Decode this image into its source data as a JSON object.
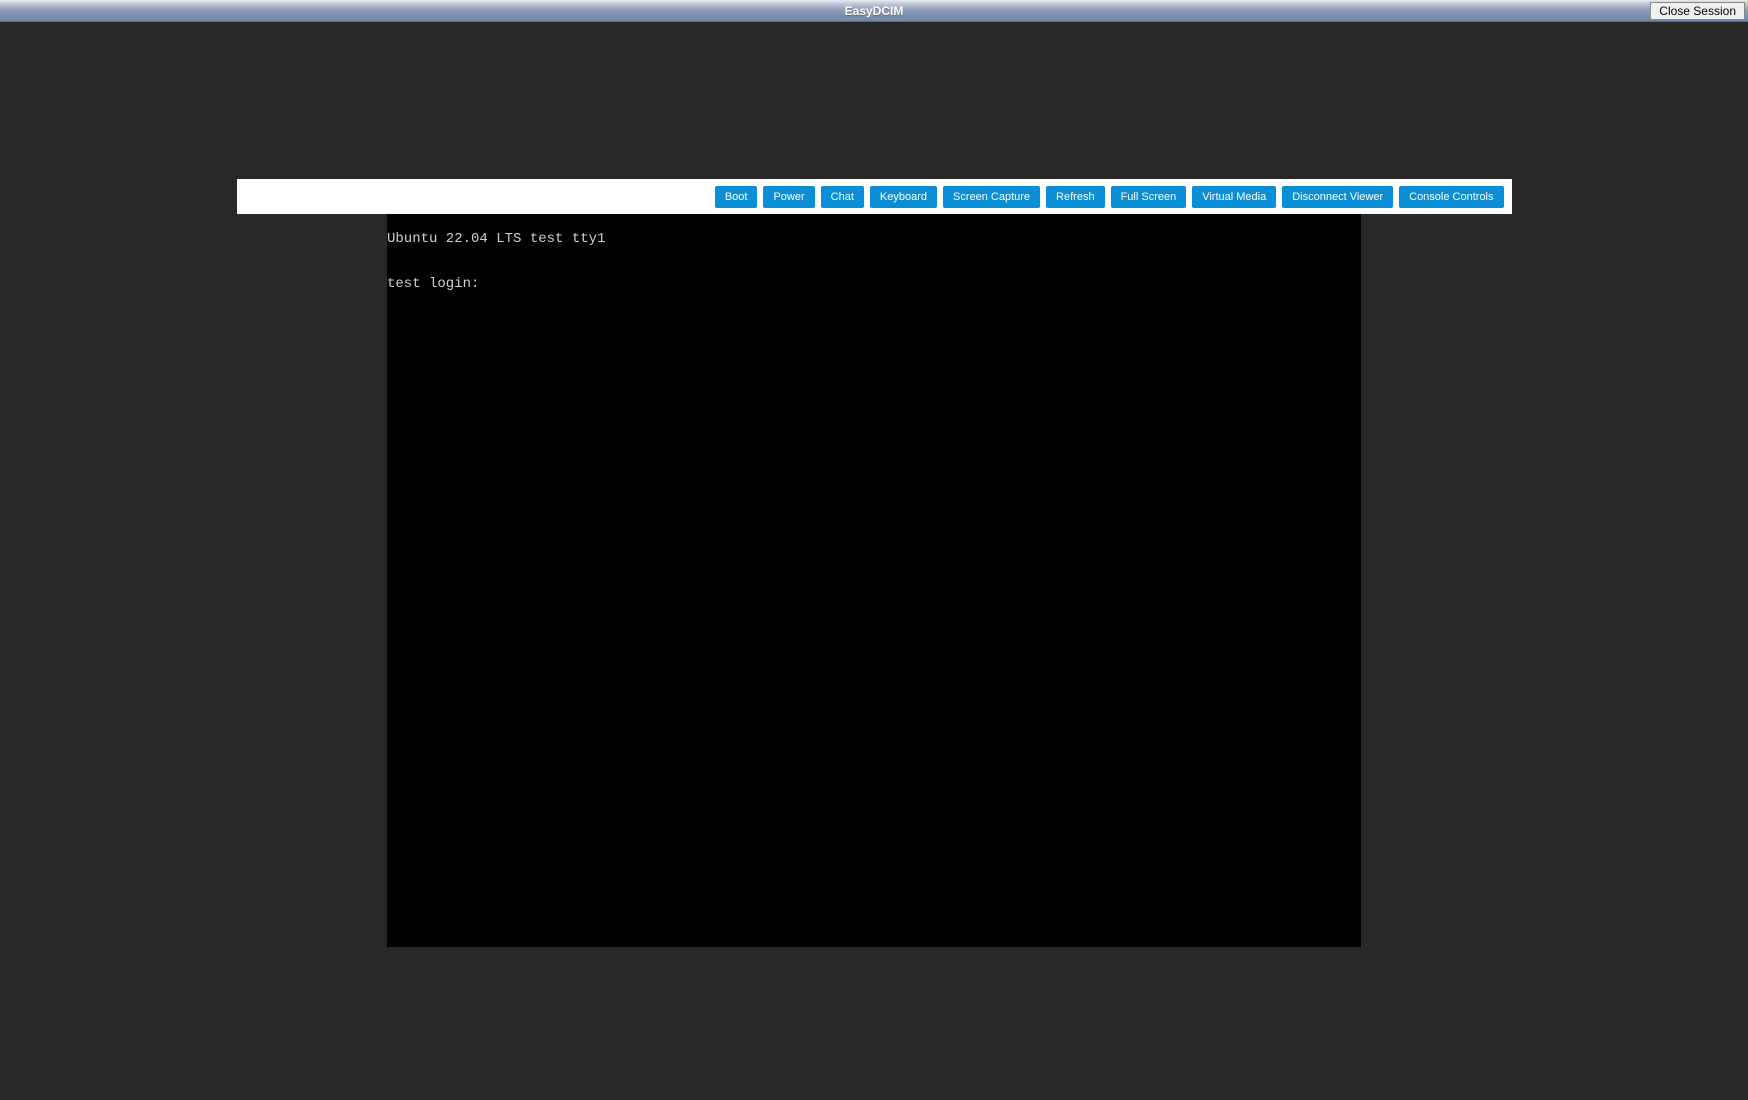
{
  "header": {
    "title": "EasyDCIM",
    "close_label": "Close Session"
  },
  "toolbar": {
    "buttons": [
      "Boot",
      "Power",
      "Chat",
      "Keyboard",
      "Screen Capture",
      "Refresh",
      "Full Screen",
      "Virtual Media",
      "Disconnect Viewer",
      "Console Controls"
    ]
  },
  "terminal": {
    "line1": "Ubuntu 22.04 LTS test tty1",
    "line2": "",
    "line3": "test login:"
  }
}
